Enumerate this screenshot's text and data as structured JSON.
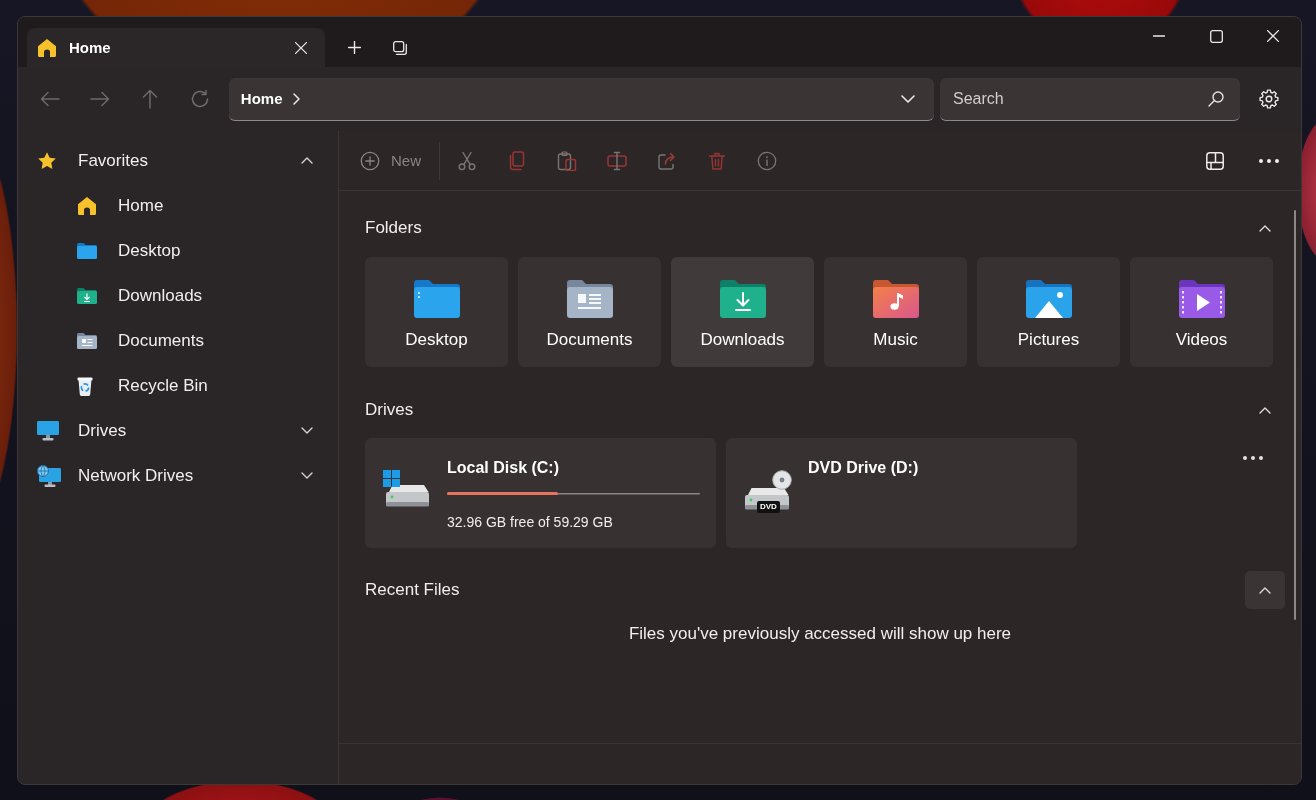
{
  "tabs": [
    {
      "label": "Home",
      "selected": true
    }
  ],
  "navigation": [
    {
      "kind": "back",
      "disabled": true
    },
    {
      "kind": "forward",
      "disabled": true
    },
    {
      "kind": "up",
      "disabled": true
    },
    {
      "kind": "refresh",
      "disabled": true
    }
  ],
  "address_bar": {
    "path": [
      "Home"
    ]
  },
  "search": {
    "placeholder": "Search"
  },
  "sidebar": {
    "sections": [
      {
        "label": "Favorites",
        "kind": "favorites",
        "expanded": true,
        "children": [
          {
            "label": "Home",
            "kind": "home"
          },
          {
            "label": "Desktop",
            "kind": "desktop"
          },
          {
            "label": "Downloads",
            "kind": "downloads"
          },
          {
            "label": "Documents",
            "kind": "documents"
          },
          {
            "label": "Recycle Bin",
            "kind": "recycle_bin"
          }
        ]
      },
      {
        "label": "Drives",
        "kind": "drives",
        "expanded": false
      },
      {
        "label": "Network Drives",
        "kind": "network",
        "expanded": false
      }
    ]
  },
  "toolbar": {
    "new": {
      "label": "New",
      "disabled": true
    },
    "actions": [
      {
        "kind": "cut",
        "disabled": true
      },
      {
        "kind": "copy",
        "disabled": true
      },
      {
        "kind": "paste",
        "disabled": true
      },
      {
        "kind": "rename",
        "disabled": true
      },
      {
        "kind": "share",
        "disabled": true
      },
      {
        "kind": "delete",
        "disabled": true
      },
      {
        "kind": "properties",
        "disabled": true
      }
    ]
  },
  "folders": {
    "title": "Folders",
    "expanded": true,
    "hovered": false,
    "items": [
      {
        "label": "Desktop",
        "kind": "desktop",
        "hovered": false
      },
      {
        "label": "Documents",
        "kind": "documents",
        "hovered": false
      },
      {
        "label": "Downloads",
        "kind": "downloads",
        "hovered": true
      },
      {
        "label": "Music",
        "kind": "music",
        "hovered": false
      },
      {
        "label": "Pictures",
        "kind": "pictures",
        "hovered": false
      },
      {
        "label": "Videos",
        "kind": "videos",
        "hovered": false
      }
    ]
  },
  "drives": {
    "title": "Drives",
    "expanded": true,
    "hovered": false,
    "items": [
      {
        "name": "Local Disk (C:)",
        "kind": "disk",
        "level": 0.44,
        "space": "32.96 GB free of 59.29 GB"
      },
      {
        "name": "DVD Drive (D:)",
        "kind": "dvd",
        "badge": "DVD"
      }
    ]
  },
  "recent_files": {
    "title": "Recent Files",
    "expanded": true,
    "hovered": true,
    "empty_message": "Files you've previously accessed will show up here"
  }
}
